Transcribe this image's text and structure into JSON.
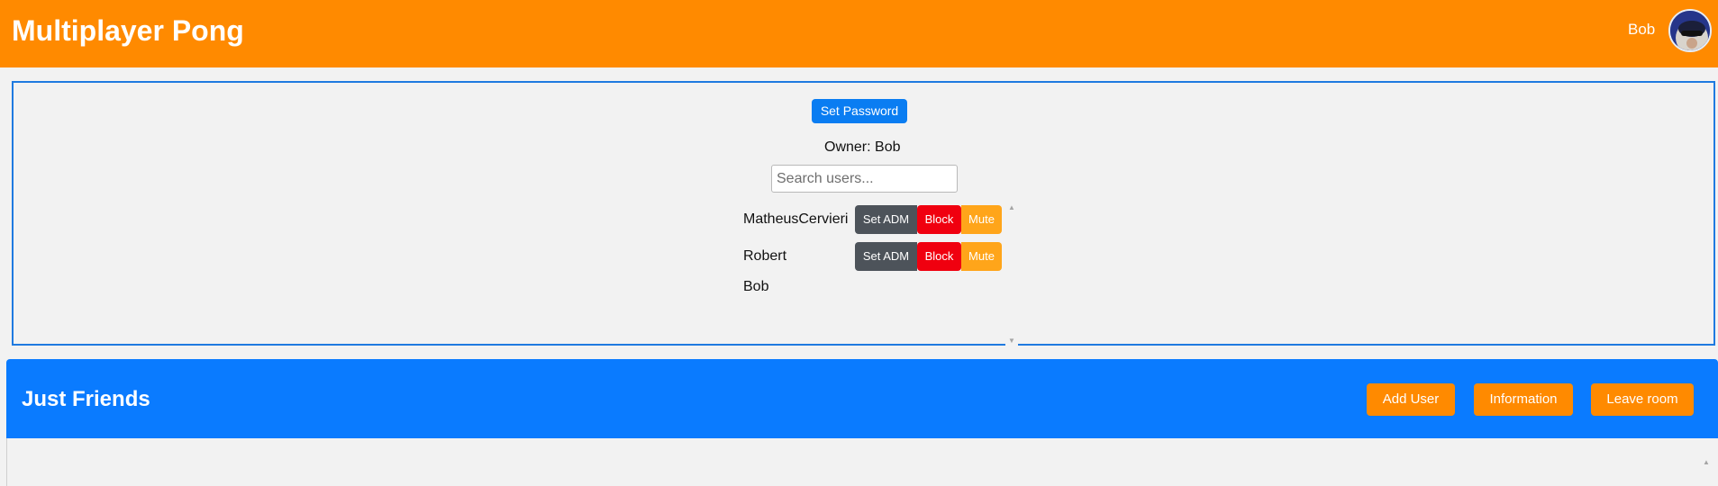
{
  "header": {
    "title": "Multiplayer Pong",
    "username": "Bob",
    "avatar_icon": "user-avatar-icon"
  },
  "panel": {
    "set_password_label": "Set Password",
    "owner_label": "Owner:",
    "owner_name": "Bob",
    "search_placeholder": "Search users...",
    "users": [
      {
        "name": "MatheusCervieri",
        "adm_label": "Set ADM",
        "block_label": "Block",
        "mute_label": "Mute"
      },
      {
        "name": "Robert",
        "adm_label": "Set ADM",
        "block_label": "Block",
        "mute_label": "Mute"
      },
      {
        "name": "Bob"
      }
    ]
  },
  "room": {
    "title": "Just Friends",
    "add_user_label": "Add User",
    "information_label": "Information",
    "leave_label": "Leave room"
  },
  "colors": {
    "header_bg": "#ff8a00",
    "room_header_bg": "#0a7bff",
    "primary_button": "#0a7df2",
    "adm_button": "#4d535a",
    "block_button": "#f0000f",
    "mute_button": "#ffa51a"
  }
}
